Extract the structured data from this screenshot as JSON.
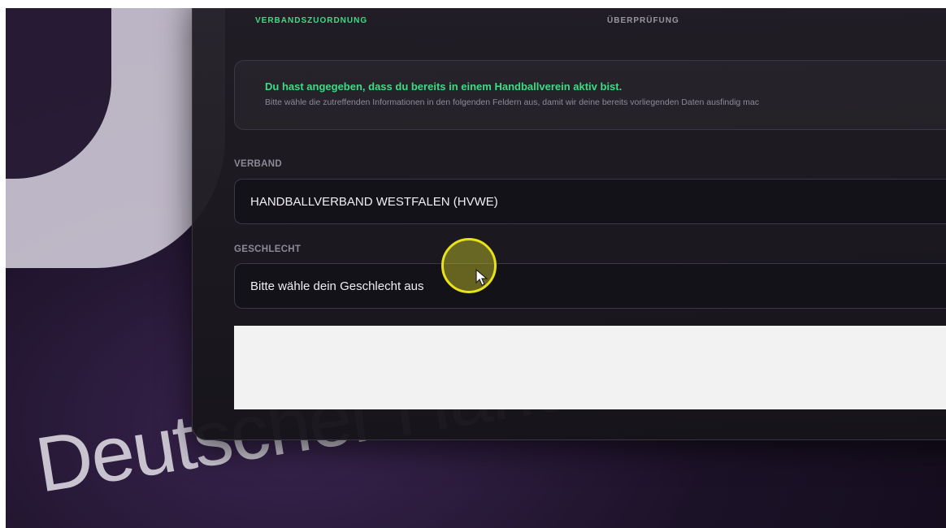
{
  "steps": {
    "active": "VERBANDSZUORDNUNG",
    "next": "ÜBERPRÜFUNG"
  },
  "info": {
    "title": "Du hast angegeben, dass du bereits in einem Handballverein aktiv bist.",
    "text": "Bitte wähle die zutreffenden Informationen in den folgenden Feldern aus, damit wir deine bereits vorliegenden Daten ausfindig mac"
  },
  "fields": {
    "verband_label": "VERBAND",
    "verband_value": "HANDBALLVERBAND WESTFALEN (HVWE)",
    "geschlecht_label": "GESCHLECHT",
    "geschlecht_placeholder": "Bitte wähle dein Geschlecht aus"
  },
  "background": {
    "text": "Deutscher Handba"
  },
  "colors": {
    "accent": "#3ddc84",
    "cursor_highlight": "#e8e21a"
  }
}
